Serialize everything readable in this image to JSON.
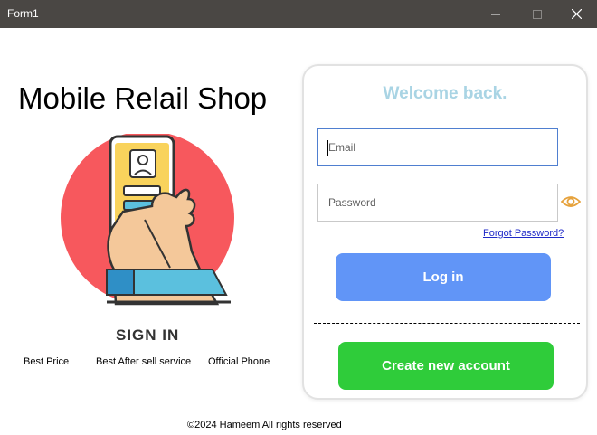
{
  "window": {
    "title": "Form1",
    "minimize_icon": "minimize-icon",
    "maximize_icon": "maximize-icon",
    "close_icon": "close-icon"
  },
  "left_panel": {
    "shop_title": "Mobile Relail Shop",
    "illustration_icon": "phone-signin-illustration",
    "signin_label": "SIGN IN",
    "features": [
      "Best Price",
      "Best After sell service",
      "Official Phone"
    ]
  },
  "login_card": {
    "welcome": "Welcome back.",
    "email_placeholder": "Email",
    "password_placeholder": "Password",
    "show_password_icon": "eye-icon",
    "forgot_password": "Forgot Password?",
    "login_button": "Log in",
    "create_account_button": "Create new account"
  },
  "footer": {
    "copyright": "©2024 Hameem All rights reserved"
  },
  "colors": {
    "titlebar": "#4a4744",
    "welcome_text": "#a9d4e4",
    "login_button": "#6195f7",
    "create_button": "#2fcc3a",
    "link": "#1f29c8",
    "eye_icon": "#e6a23c",
    "illustration_circle": "#f7585d"
  }
}
